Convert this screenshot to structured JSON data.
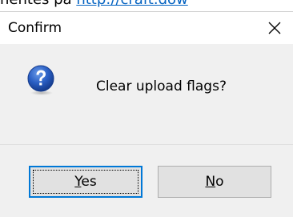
{
  "background": {
    "text": "nentes på",
    "link": "http://craft.dow"
  },
  "dialog": {
    "title": "Confirm",
    "close_icon": "close-icon",
    "message": "Clear upload flags?",
    "icon": "question-icon",
    "buttons": {
      "yes": {
        "mnemonic": "Y",
        "rest": "es"
      },
      "no": {
        "mnemonic": "N",
        "rest": "o"
      }
    }
  },
  "colors": {
    "dialog_body": "#f0f0f0",
    "button_face": "#e1e1e1",
    "default_button_border": "#0078d7",
    "icon_blue": "#1f4fb3",
    "link": "#0563c1"
  }
}
